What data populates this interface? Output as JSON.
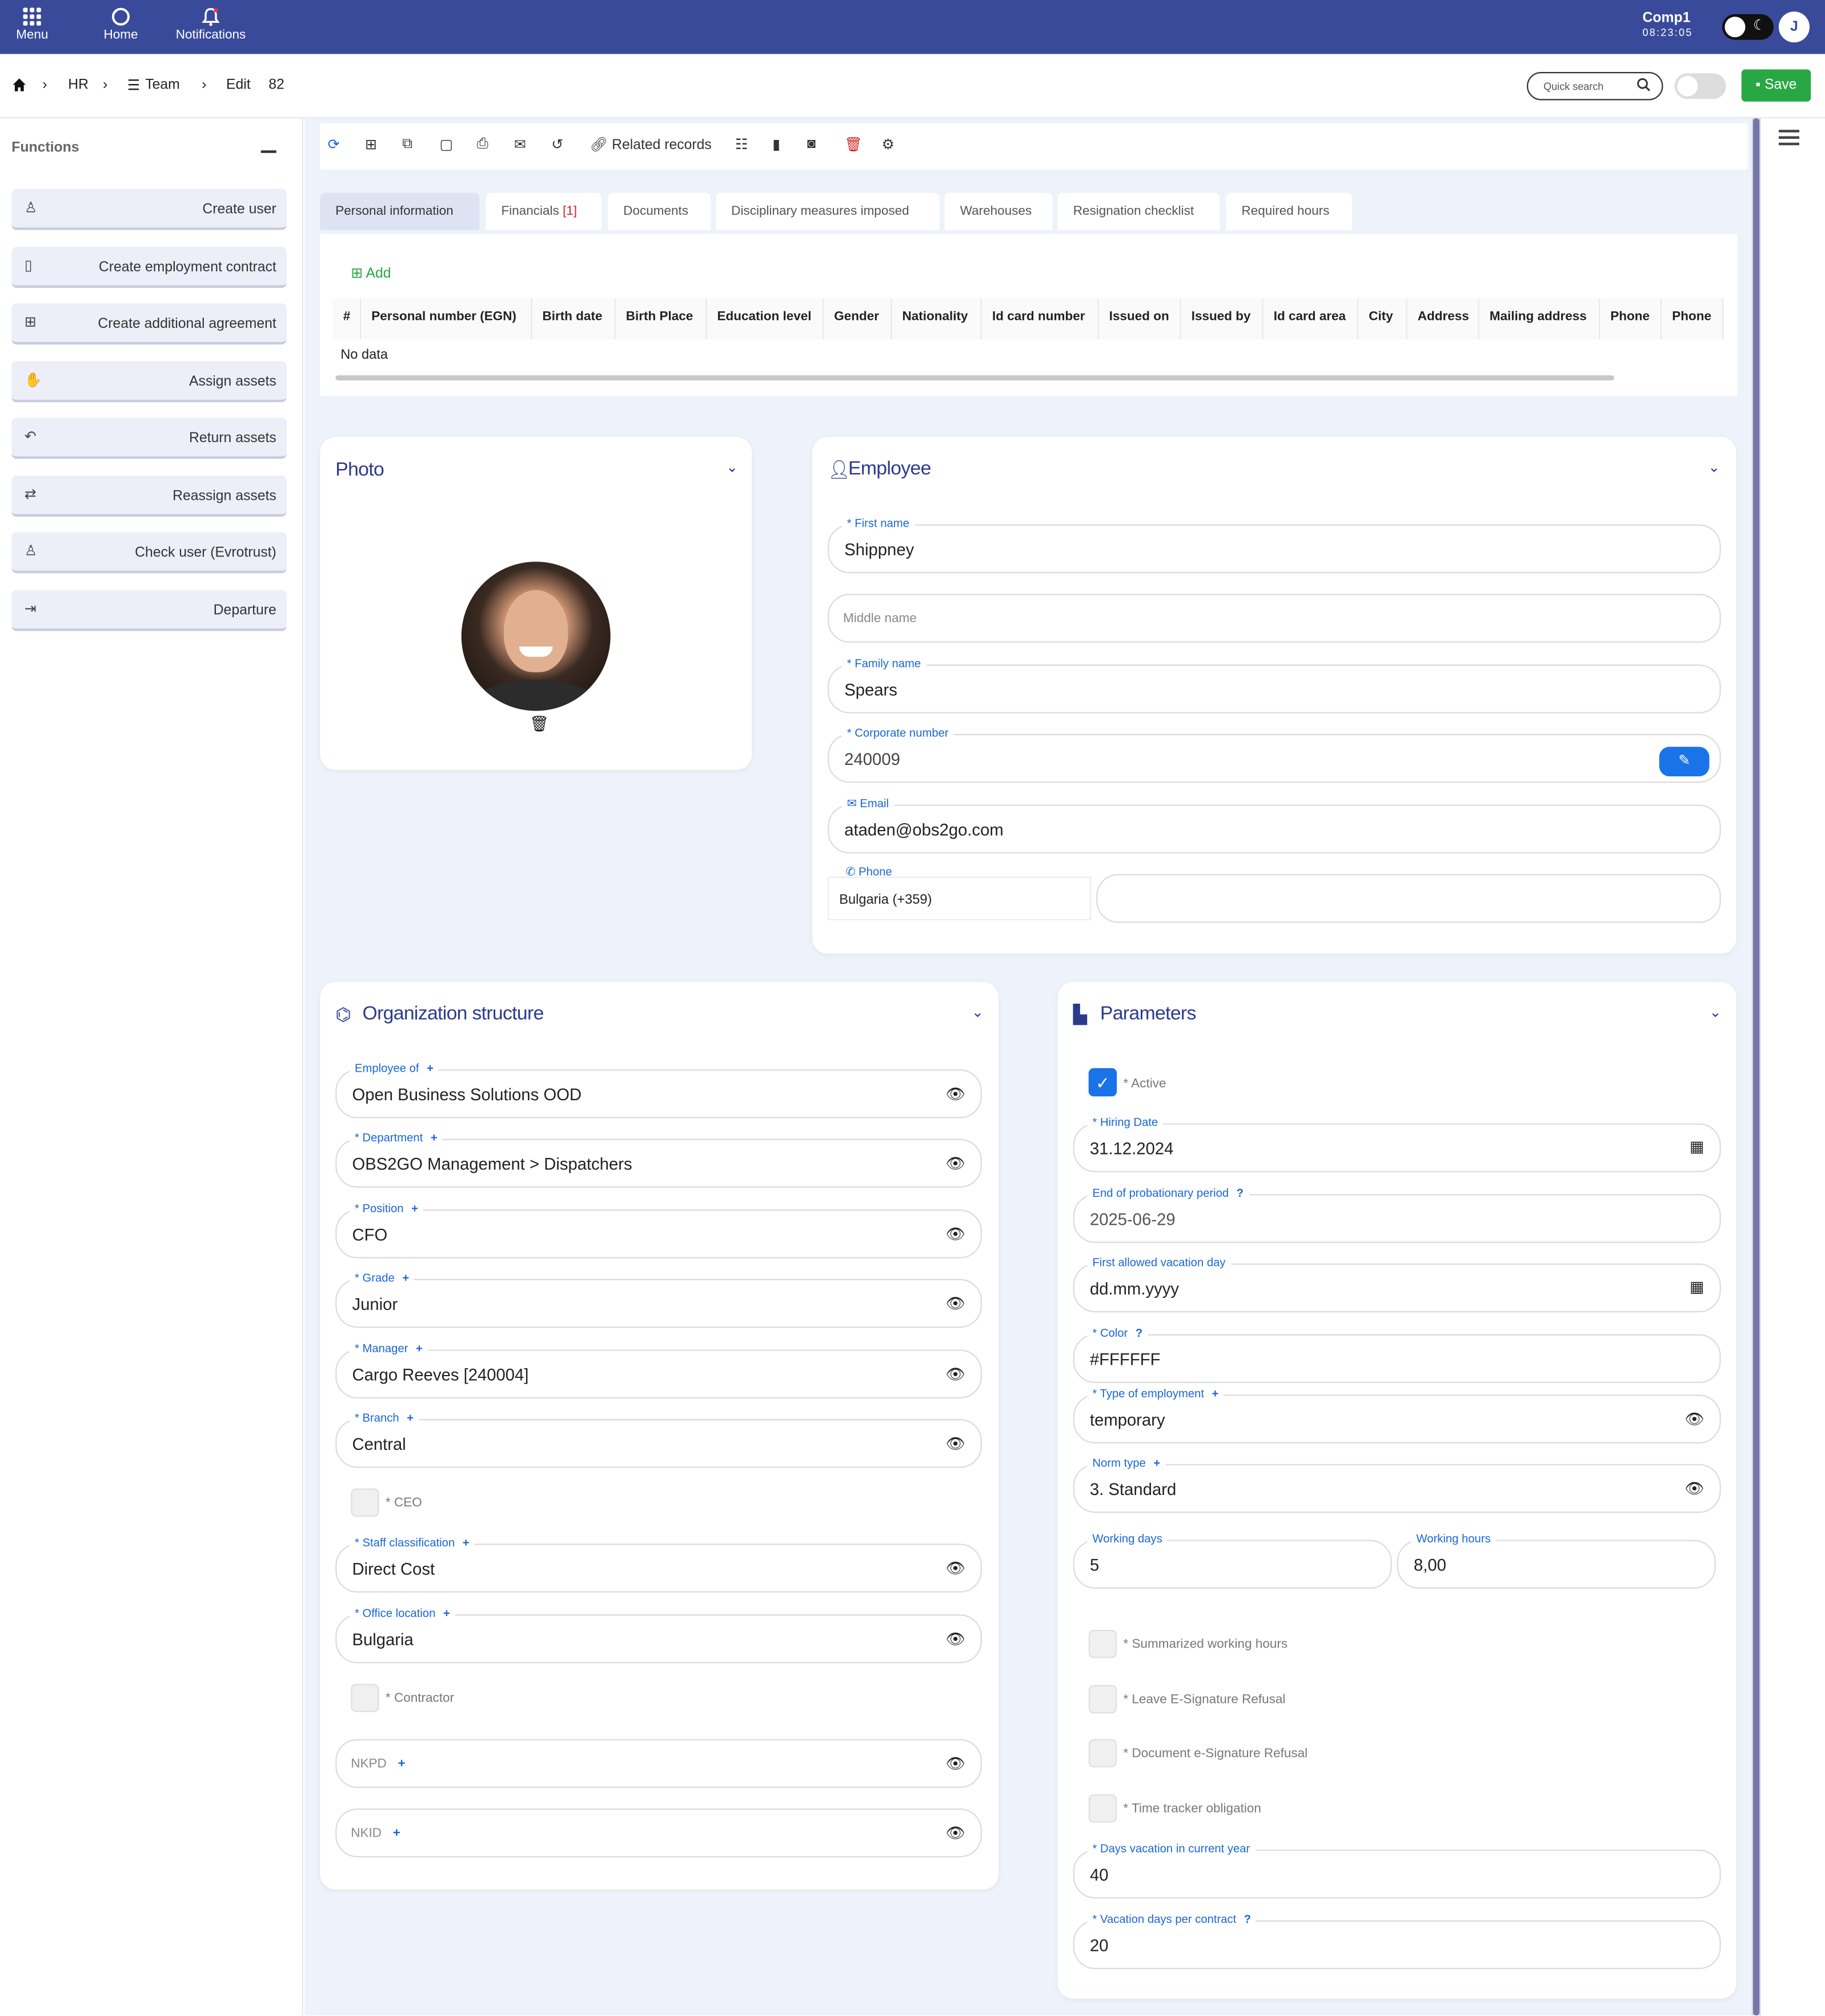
{
  "topbar": {
    "menu": "Menu",
    "home": "Home",
    "notifications": "Notifications",
    "company": "Comp1",
    "clock": "08:23:05",
    "user_initial": "J",
    "menu_icon": "grid-icon",
    "home_icon": "refresh-circle-icon",
    "notif_icon": "bell-icon"
  },
  "breadcrumb": {
    "hr": "HR",
    "team": "Team",
    "edit": "Edit",
    "id": "82",
    "search_placeholder": "Quick search",
    "save": "Save"
  },
  "functions": {
    "title": "Functions",
    "items": [
      {
        "label": "Create user",
        "icon": "user-icon"
      },
      {
        "label": "Create employment contract",
        "icon": "document-icon"
      },
      {
        "label": "Create additional agreement",
        "icon": "plus-square-icon"
      },
      {
        "label": "Assign assets",
        "icon": "hand-icon"
      },
      {
        "label": "Return assets",
        "icon": "undo-icon"
      },
      {
        "label": "Reassign assets",
        "icon": "swap-icon"
      },
      {
        "label": "Check user (Evrotrust)",
        "icon": "user-check-icon"
      },
      {
        "label": "Departure",
        "icon": "exit-icon"
      }
    ]
  },
  "toolbar": {
    "related_records": "Related records"
  },
  "tabs": [
    {
      "label": "Personal information"
    },
    {
      "label": "Financials",
      "badge": "[1]"
    },
    {
      "label": "Documents"
    },
    {
      "label": "Disciplinary measures imposed"
    },
    {
      "label": "Warehouses"
    },
    {
      "label": "Resignation checklist"
    },
    {
      "label": "Required hours"
    }
  ],
  "personal_table": {
    "add": "Add",
    "columns": [
      "#",
      "Personal number (EGN)",
      "Birth date",
      "Birth Place",
      "Education level",
      "Gender",
      "Nationality",
      "Id card number",
      "Issued on",
      "Issued by",
      "Id card area",
      "City",
      "Address",
      "Mailing address",
      "Phone",
      "Phone"
    ],
    "empty": "No data"
  },
  "photo": {
    "title": "Photo"
  },
  "employee": {
    "title": "Employee",
    "first_name_label": "* First name",
    "first_name": "Shippney",
    "middle_name_placeholder": "Middle name",
    "family_name_label": "* Family name",
    "family_name": "Spears",
    "corporate_number_label": "* Corporate number",
    "corporate_number": "240009",
    "email_label": "Email",
    "email": "ataden@obs2go.com",
    "phone_label": "Phone",
    "phone_country": "Bulgaria (+359)",
    "phone": ""
  },
  "org": {
    "title": "Organization structure",
    "employee_of_label": "Employee of",
    "employee_of": "Open Business Solutions OOD",
    "department_label": "* Department",
    "department": "OBS2GO Management > Dispatchers",
    "position_label": "* Position",
    "position": "CFO",
    "grade_label": "* Grade",
    "grade": "Junior",
    "manager_label": "* Manager",
    "manager": "Cargo Reeves [240004]",
    "branch_label": "* Branch",
    "branch": "Central",
    "ceo_label": "* CEO",
    "staff_label": "* Staff classification",
    "staff": "Direct Cost",
    "office_label": "* Office location",
    "office": "Bulgaria",
    "contractor_label": "* Contractor",
    "nkpd": "NKPD",
    "nkid": "NKID"
  },
  "params": {
    "title": "Parameters",
    "active_label": "* Active",
    "hiring_label": "* Hiring Date",
    "hiring": "31.12.2024",
    "probation_label": "End of probationary period",
    "probation": "2025-06-29",
    "vacation_day_label": "First allowed vacation day",
    "vacation_day": "dd.mm.yyyy",
    "color_label": "* Color",
    "color": "#FFFFFF",
    "type_label": "* Type of employment",
    "type": "temporary",
    "norm_label": "Norm type",
    "norm": "3. Standard",
    "wdays_label": "Working days",
    "wdays": "5",
    "whours_label": "Working hours",
    "whours": "8,00",
    "summarized_label": "* Summarized working hours",
    "leave_label": "* Leave E-Signature Refusal",
    "doc_label": "* Document e-Signature Refusal",
    "tracker_label": "* Time tracker obligation",
    "days_vac_label": "* Days vacation in current year",
    "days_vac": "40",
    "vac_contract_label": "* Vacation days per contract",
    "vac_contract": "20"
  },
  "colors": {
    "topbar": "#3a4a9a",
    "accent": "#1a66d8",
    "save": "#28a745",
    "delete": "#d62222"
  }
}
